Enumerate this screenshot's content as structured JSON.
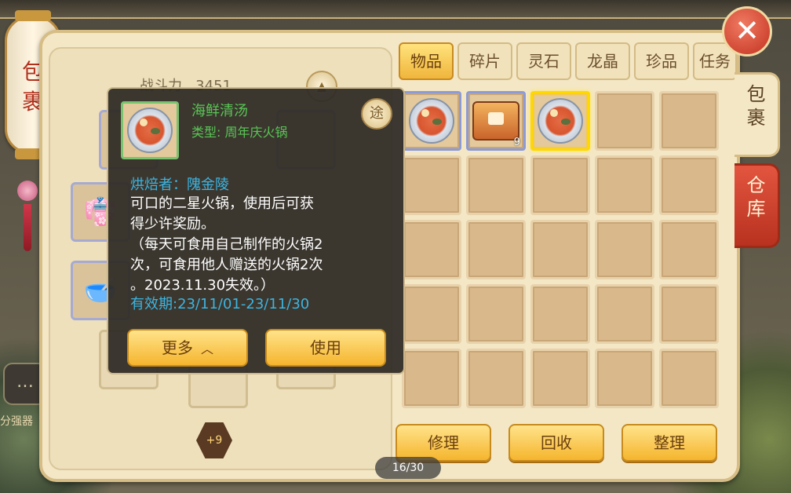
{
  "lantern": {
    "title": "包\n裹"
  },
  "character": {
    "power_label": "战斗力",
    "power_value": "3451",
    "enhance_badge": "+9"
  },
  "tabs": [
    "物品",
    "碎片",
    "灵石",
    "龙晶",
    "珍品",
    "任务"
  ],
  "side_tabs": {
    "bag": "包\n裹",
    "warehouse": "仓\n库"
  },
  "grid": {
    "items": [
      {
        "icon": "hotpot-bowl-icon",
        "count": ""
      },
      {
        "icon": "tofu-plate-icon",
        "count": "9"
      },
      {
        "icon": "hotpot-bowl-icon",
        "count": "",
        "selected": true
      }
    ],
    "total_cells": 25
  },
  "buttons": {
    "repair": "修理",
    "recycle": "回收",
    "sort": "整理"
  },
  "page_indicator": "16/30",
  "tooltip": {
    "name": "海鲜清汤",
    "type": "类型: 周年庆火锅",
    "use_badge": "途",
    "maker": "烘焙者：隗金陵",
    "description": [
      "可口的二星火锅，使用后可获",
      "得少许奖励。",
      "（每天可食用自己制作的火锅2",
      "次，可食用他人赠送的火锅2次",
      "。2023.11.30失效。）"
    ],
    "validity": "有效期:23/11/01-23/11/30",
    "more_button": "更多",
    "use_button": "使用"
  },
  "chat": {
    "label": "分强器"
  },
  "colors": {
    "tooltip_name": "#59c655",
    "tooltip_maker": "#3db4e0",
    "tab_active": "#f0b53b",
    "selected_border": "#ffd800"
  }
}
